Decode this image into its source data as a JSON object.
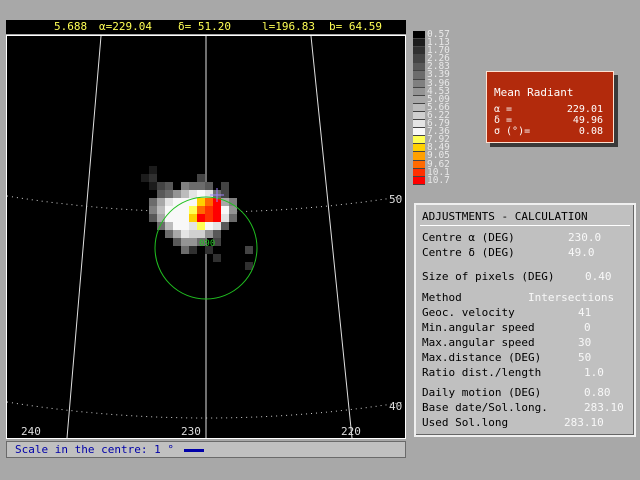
{
  "status": {
    "value": "5.688",
    "alpha": "α=229.04",
    "delta": "δ= 51.20",
    "l": "l=196.83",
    "b": "b= 64.59"
  },
  "map": {
    "ticks_bottom": [
      "240",
      "230",
      "220"
    ],
    "ticks_right": [
      "50",
      "40"
    ],
    "label_green": "090"
  },
  "legend": {
    "values": [
      "0.57",
      "1.13",
      "1.70",
      "2.26",
      "2.83",
      "3.39",
      "3.96",
      "4.53",
      "5.09",
      "5.66",
      "6.22",
      "6.79",
      "7.36",
      "7.92",
      "8.49",
      "9.05",
      "9.62",
      "10.1",
      "10.7"
    ],
    "colors": [
      "#000000",
      "#1c1c1c",
      "#303030",
      "#444444",
      "#585858",
      "#6c6c6c",
      "#808080",
      "#949494",
      "#a8a8a8",
      "#bcbcbc",
      "#d0d0d0",
      "#e4e4e4",
      "#f8f8f8",
      "#ffff55",
      "#ffd000",
      "#ffa000",
      "#ff6a00",
      "#ff3000",
      "#ff0000"
    ]
  },
  "mean_radiant": {
    "title": "Mean Radiant",
    "alpha_label": "α =",
    "alpha_value": "229.01",
    "delta_label": "δ =",
    "delta_value": "49.96",
    "sigma_label": "σ (°)=",
    "sigma_value": "0.08"
  },
  "adjustments": {
    "title": "ADJUSTMENTS - CALCULATION",
    "centre_alpha_label": "Centre α (DEG)",
    "centre_alpha_value": "230.0",
    "centre_delta_label": "Centre δ (DEG)",
    "centre_delta_value": "49.0",
    "pixel_size_label": "Size of pixels (DEG)",
    "pixel_size_value": "0.40",
    "method_label": "Method",
    "method_value": "Intersections",
    "geoc_label": "Geoc. velocity",
    "geoc_value": "41",
    "min_ang_label": "Min.angular speed",
    "min_ang_value": "0",
    "max_ang_label": "Max.angular speed",
    "max_ang_value": "30",
    "max_dist_label": "Max.distance (DEG)",
    "max_dist_value": "50",
    "ratio_label": "Ratio dist./length",
    "ratio_value": "1.0",
    "daily_label": "Daily motion (DEG)",
    "daily_value": "0.80",
    "base_label": "Base date/Sol.long.",
    "base_value": "283.10",
    "used_label": "Used Sol.long",
    "used_value": "283.10"
  },
  "scale": {
    "label": "Scale in the centre: 1 °"
  }
}
